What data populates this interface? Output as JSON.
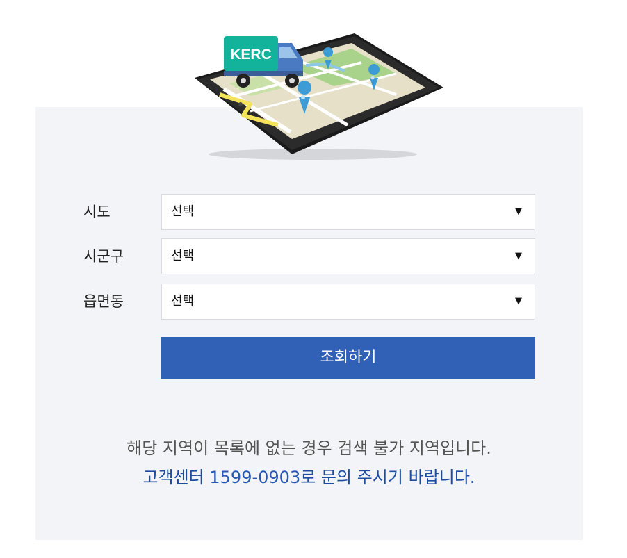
{
  "logo_text": "KERC",
  "form": {
    "rows": [
      {
        "label": "시도",
        "value": "선택"
      },
      {
        "label": "시군구",
        "value": "선택"
      },
      {
        "label": "읍면동",
        "value": "선택"
      }
    ],
    "submit_label": "조회하기"
  },
  "notice": {
    "line1": "해당 지역이 목록에 없는 경우 검색 불가 지역입니다.",
    "line2_prefix": "고객센터 ",
    "phone": "1599-0903",
    "line2_suffix": "로 문의 주시기 바랍니다",
    "line2_end": "."
  },
  "colors": {
    "panel_bg": "#f3f4f8",
    "button_bg": "#3160b7",
    "notice_link": "#1d4da3",
    "truck_cab": "#4a7ac1",
    "truck_box": "#12b39a"
  },
  "icons": {
    "select_arrow": "▼",
    "hero": "tablet-map-truck-illustration"
  }
}
